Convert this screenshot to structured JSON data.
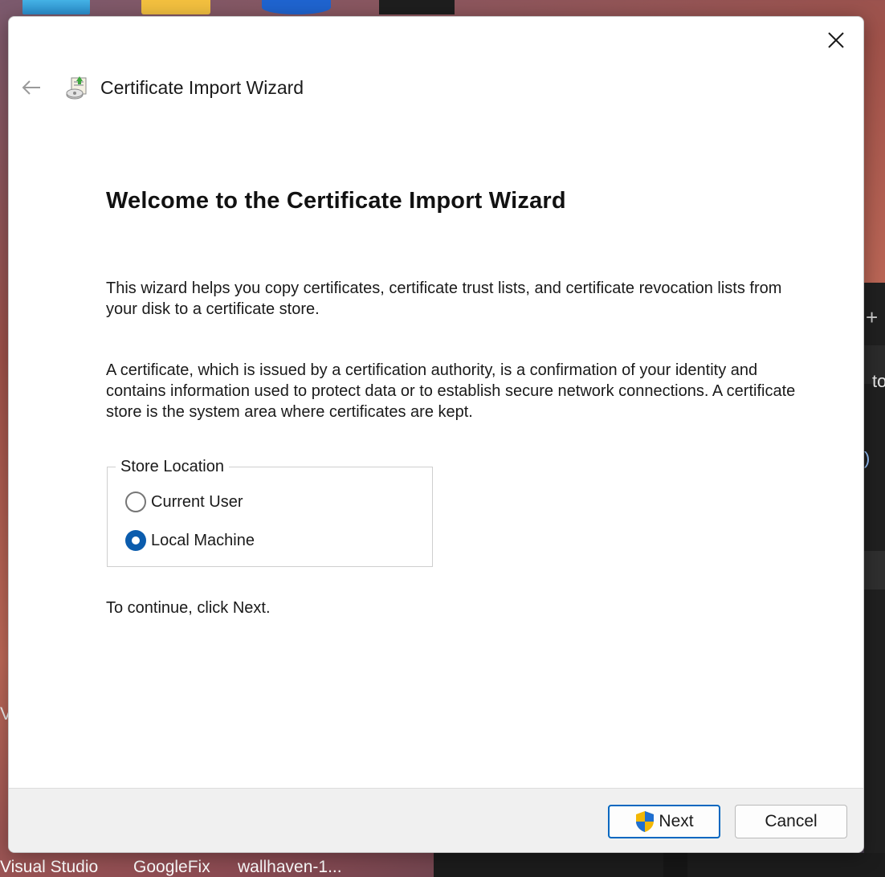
{
  "window": {
    "title": "Certificate Import Wizard"
  },
  "page": {
    "heading": "Welcome to the Certificate Import Wizard",
    "paragraph1": "This wizard helps you copy certificates, certificate trust lists, and certificate revocation lists from your disk to a certificate store.",
    "paragraph2": "A certificate, which is issued by a certification authority, is a confirmation of your identity and contains information used to protect data or to establish secure network connections. A certificate store is the system area where certificates are kept.",
    "store_location": {
      "label": "Store Location",
      "options": [
        {
          "label": "Current User",
          "selected": false
        },
        {
          "label": "Local Machine",
          "selected": true
        }
      ]
    },
    "continue_text": "To continue, click Next."
  },
  "footer": {
    "next_label": "Next",
    "cancel_label": "Cancel"
  },
  "background": {
    "taskbar_labels": [
      "Visual Studio",
      "GoogleFix",
      "wallhaven-1..."
    ],
    "side_text": "to",
    "left_text": "V"
  },
  "colors": {
    "accent": "#0067c0",
    "radio_selected": "#0b5cad",
    "footer_bg": "#f0f0f0"
  }
}
